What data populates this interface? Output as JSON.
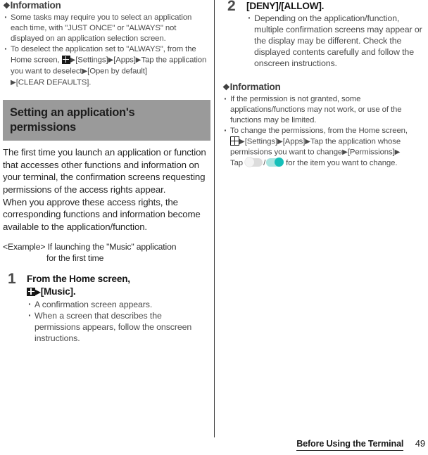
{
  "page": {
    "number": "49",
    "footer_title": "Before Using the Terminal"
  },
  "icons": {
    "floret": "❖",
    "arrow": "▶",
    "apps_grid": "apps-grid-icon"
  },
  "left_column": {
    "information_heading": "Information",
    "information_bullets": [
      {
        "id": "bullet-just-once",
        "parts": [
          {
            "type": "text",
            "value": "Some tasks may require you to select an application each time, with \"JUST ONCE\" or \"ALWAYS\" not displayed on an application selection screen."
          }
        ],
        "plain": "Some tasks may require you to select an application each time, with \"JUST ONCE\" or \"ALWAYS\" not displayed on an application selection screen."
      },
      {
        "id": "bullet-clear-defaults",
        "segments": {
          "s1": "To deselect the application set to \"ALWAYS\", from the Home screen, ",
          "s2": "[Settings]",
          "s3": "[Apps]",
          "s4": "Tap the application you want to deselect",
          "s5": "[Open by default]",
          "s6": "[CLEAR DEFAULTS]."
        },
        "plain": "To deselect the application set to \"ALWAYS\", from the Home screen, [apps]▶[Settings]▶[Apps]▶Tap the application you want to deselect▶[Open by default]▶[CLEAR DEFAULTS]."
      }
    ],
    "section_heading": "Setting an application's permissions",
    "paragraph_1": "The first time you launch an application or function that accesses other functions and information on your terminal, the confirmation screens requesting permissions of the access rights appear.",
    "paragraph_2": "When you approve these access rights, the corresponding functions and information become available to the application/function.",
    "example": {
      "label": "<Example>",
      "line1": "If launching the \"Music\" application",
      "line2": "for the first time"
    },
    "step_1": {
      "number": "1",
      "title_line1": "From the Home screen,",
      "title_line2": "[Music].",
      "bullets": [
        "A confirmation screen appears.",
        "When a screen that describes the permissions appears, follow the onscreen instructions."
      ]
    }
  },
  "right_column": {
    "step_2": {
      "number": "2",
      "title": "[DENY]/[ALLOW].",
      "bullets": [
        "Depending on the application/function, multiple confirmation screens may appear or the display may be different. Check the displayed contents carefully and follow the onscreen instructions."
      ]
    },
    "information_heading": "Information",
    "information_bullets": [
      {
        "id": "bullet-permission-not-granted",
        "plain": "If the permission is not granted, some applications/functions may not work, or use of the functions may be limited."
      },
      {
        "id": "bullet-change-permissions",
        "segments": {
          "s1": "To change the permissions, from the Home screen,",
          "s2": "[Settings]",
          "s3": "[Apps]",
          "s4": "Tap the application whose permissions you want to change",
          "s5": "[Permissions]",
          "s6": "Tap",
          "s7": "/",
          "s8": "for the item you want to change."
        },
        "plain": "To change the permissions, from the Home screen, [apps]▶[Settings]▶[Apps]▶Tap the application whose permissions you want to change▶[Permissions]▶Tap [off] / [on] for the item you want to change."
      }
    ]
  },
  "colors": {
    "section_band_bg": "#9a9a9a",
    "toggle_on": "#15bfb9",
    "toggle_on_track": "#a9e4e0",
    "toggle_off_track": "#dcdcdc",
    "body_text": "#262626",
    "bullet_text": "#4b4b4b"
  }
}
